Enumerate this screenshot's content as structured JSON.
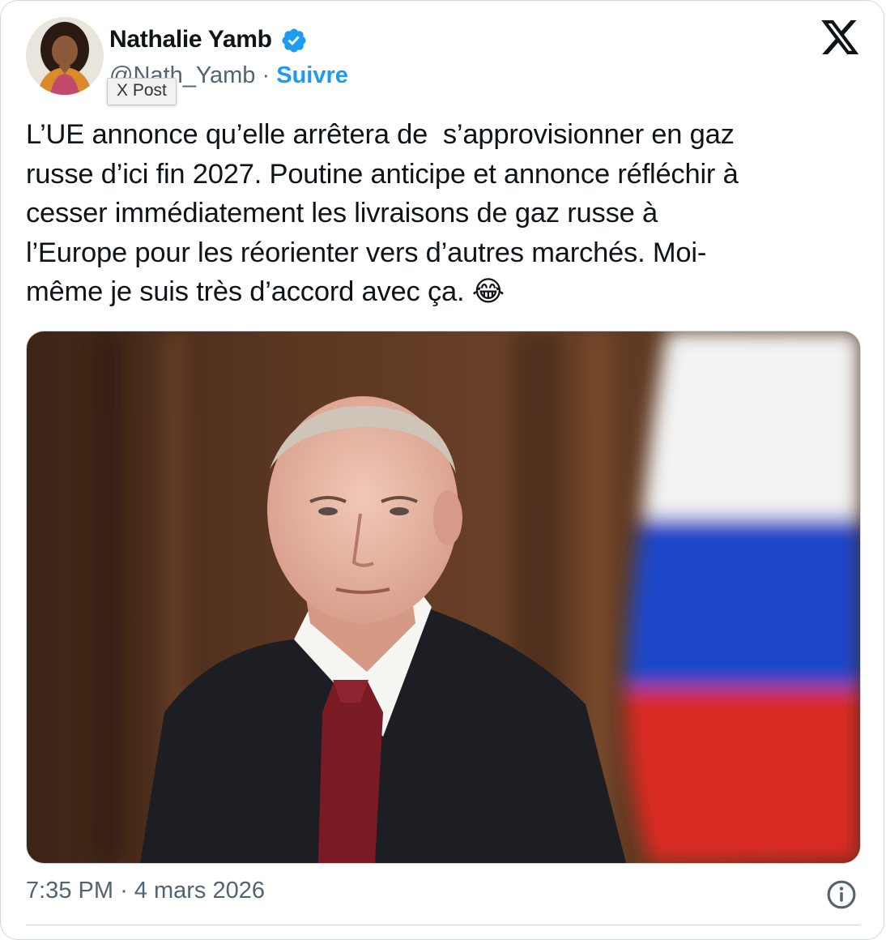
{
  "author": {
    "name": "Nathalie Yamb",
    "handle": "@Nath_Yamb",
    "separator": "·",
    "follow_label": "Suivre",
    "verified": true
  },
  "tooltip": "X Post",
  "platform_logo": "x-logo",
  "tweet": {
    "text": "L’UE annonce qu’elle arrêtera de  s’approvisionner en gaz\nrusse d’ici fin 2027. Poutine anticipe et annonce réfléchir à\ncesser immédiatement les livraisons de gaz russe à\nl’Europe pour les réorienter vers d’autres marchés. Moi-\nmême je suis très d’accord avec ça. 😂"
  },
  "meta": {
    "time": "7:35 PM",
    "separator": "·",
    "date": "4 mars 2026"
  },
  "icons": {
    "verified": "verified-badge-icon",
    "logo": "x-logo-icon",
    "info": "info-icon"
  },
  "colors": {
    "accent": "#1d9bf0",
    "text": "#0f1419",
    "secondary": "#536471",
    "border": "#cfd9de"
  }
}
